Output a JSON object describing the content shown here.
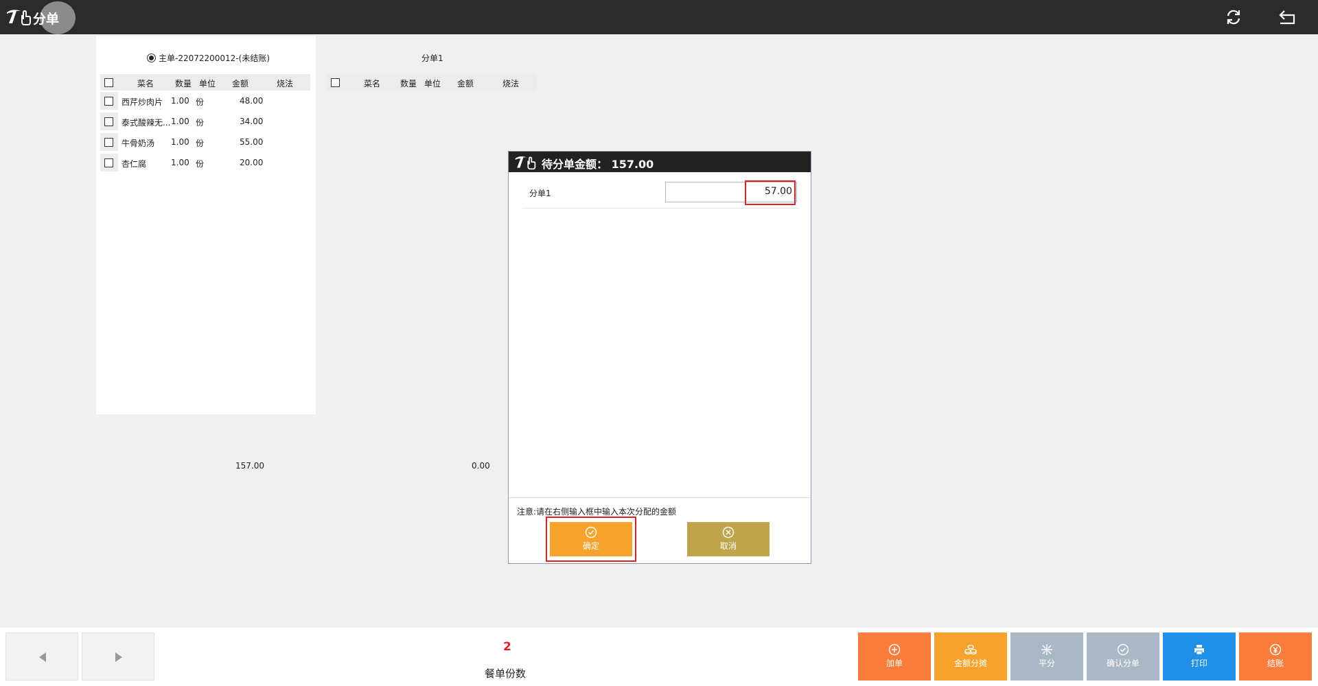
{
  "header": {
    "title": "分单"
  },
  "colors": {
    "topbar": "#2b2b2b",
    "add_button": "#fb7d3c",
    "amount_split_button": "#f7a22c",
    "even_button": "#aab8c6",
    "confirm_split_button": "#aab8c6",
    "print_button": "#1f8fea",
    "checkout_button": "#fb7d3c",
    "highlight": "#e02020"
  },
  "main_order": {
    "title": "主单-22072200012-(未结账)",
    "columns": [
      "菜名",
      "数量",
      "单位",
      "金额",
      "烧法"
    ],
    "rows": [
      {
        "name": "西芹炒肉片",
        "qty": "1.00",
        "unit": "份",
        "amount": "48.00"
      },
      {
        "name": "泰式酸辣无...",
        "qty": "1.00",
        "unit": "份",
        "amount": "34.00"
      },
      {
        "name": "牛骨奶汤",
        "qty": "1.00",
        "unit": "份",
        "amount": "55.00"
      },
      {
        "name": "杏仁腐",
        "qty": "1.00",
        "unit": "份",
        "amount": "20.00"
      }
    ],
    "total": "157.00"
  },
  "sub_order": {
    "title": "分单1",
    "columns": [
      "菜名",
      "数量",
      "单位",
      "金额",
      "烧法"
    ],
    "total": "0.00"
  },
  "dialog": {
    "title": "待分单金额： 157.00",
    "split_label": "分单1",
    "split_value": "57.00",
    "note": "注意:请在右侧输入框中输入本次分配的金额",
    "ok_label": "确定",
    "cancel_label": "取消"
  },
  "bottom": {
    "count_value": "2",
    "count_label": "餐单份数",
    "buttons": {
      "add": "加单",
      "amount_split": "金额分摊",
      "even": "平分",
      "confirm_split": "确认分单",
      "print": "打印",
      "checkout": "结账"
    }
  }
}
